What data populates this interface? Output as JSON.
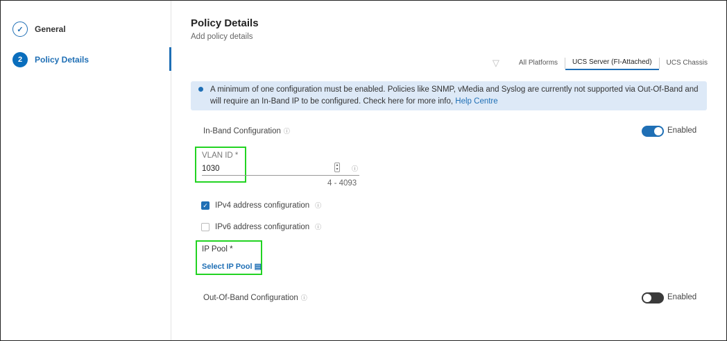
{
  "steps": [
    {
      "label": "General",
      "state": "done"
    },
    {
      "number": "2",
      "label": "Policy Details",
      "state": "active"
    }
  ],
  "header": {
    "title": "Policy Details",
    "subtitle": "Add policy details"
  },
  "tabs": [
    {
      "label": "All Platforms"
    },
    {
      "label": "UCS Server (FI-Attached)",
      "selected": true
    },
    {
      "label": "UCS Chassis"
    }
  ],
  "banner": {
    "text": "A minimum of one configuration must be enabled. Policies like SNMP, vMedia and Syslog are currently not supported via Out-Of-Band and will require an In-Band IP to be configured. Check here for more info, ",
    "link": "Help Centre"
  },
  "inband": {
    "label": "In-Band Configuration",
    "toggle_label": "Enabled",
    "enabled": true
  },
  "vlan": {
    "label": "VLAN ID *",
    "value": "1030",
    "range": "4 - 4093"
  },
  "ipv4": {
    "label": "IPv4 address configuration",
    "checked": true
  },
  "ipv6": {
    "label": "IPv6 address configuration",
    "checked": false
  },
  "ippool": {
    "label": "IP Pool *",
    "link": "Select IP Pool"
  },
  "outofband": {
    "label": "Out-Of-Band Configuration",
    "toggle_label": "Enabled",
    "enabled": false
  },
  "colors": {
    "accent": "#1f6fb5",
    "highlight": "#22d322"
  }
}
